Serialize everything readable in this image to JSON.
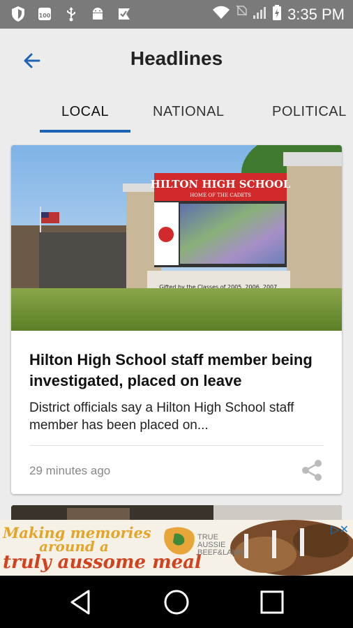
{
  "status_bar": {
    "time": "3:35 PM",
    "icons": [
      "shield-icon",
      "app-100-icon",
      "usb-icon",
      "android-icon",
      "check-flag-icon",
      "wifi-icon",
      "no-sim-icon",
      "signal-icon",
      "battery-icon"
    ]
  },
  "header": {
    "title": "Headlines",
    "back_icon": "arrow-back-icon"
  },
  "tabs": [
    {
      "label": "LOCAL",
      "active": true
    },
    {
      "label": "NATIONAL",
      "active": false
    },
    {
      "label": "POLITICAL",
      "active": false
    }
  ],
  "article": {
    "image_sign_title": "HILTON HIGH SCHOOL",
    "image_sign_subtitle": "HOME OF THE CADETS",
    "image_sign_caption": "Gifted by the Classes of 2005, 2006, 2007.",
    "headline": "Hilton High School staff member being investigated, placed on leave",
    "summary": "District officials say a Hilton High School staff member has been placed on...",
    "time": "29 minutes ago",
    "share_icon": "share-icon"
  },
  "ad": {
    "line1": "Making memories",
    "line2": "around a",
    "line3": "truly aussome meal",
    "brand_lines": [
      "TRUE",
      "AUSSIE",
      "BEEF&LAMB"
    ],
    "colors": {
      "gold": "#e3a52a",
      "red": "#d2421f"
    }
  },
  "nav": {
    "back": "nav-back-icon",
    "home": "nav-home-icon",
    "recents": "nav-recents-icon"
  },
  "colors": {
    "accent": "#1f63b6",
    "status_bar": "#7a7a7a",
    "background": "#ececec"
  }
}
